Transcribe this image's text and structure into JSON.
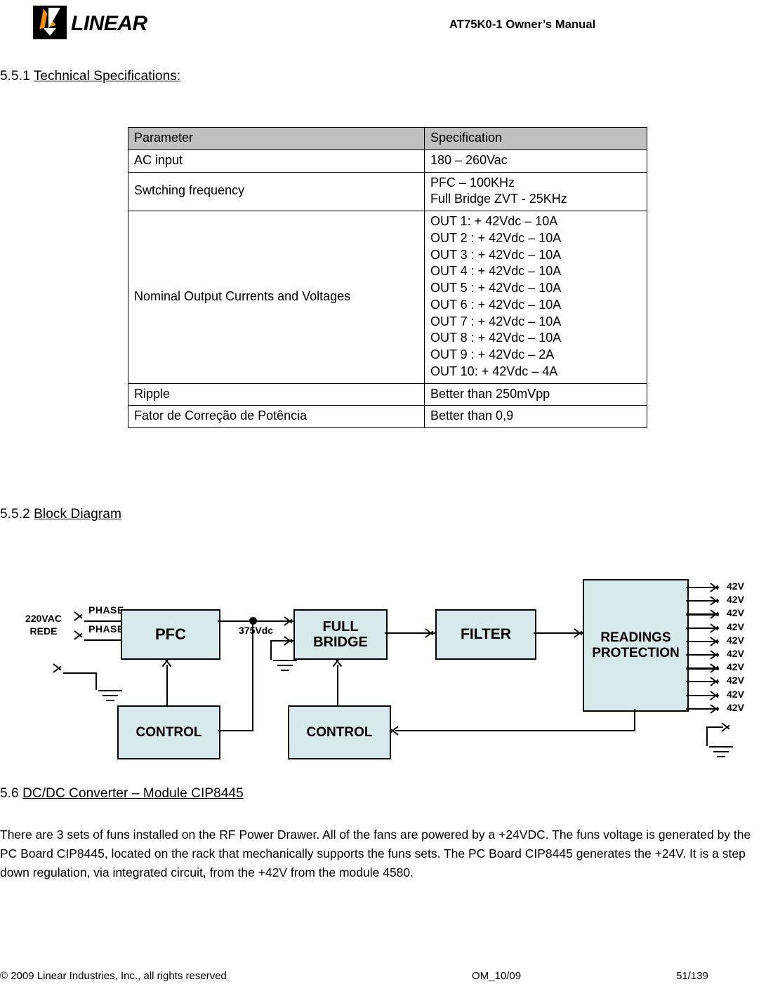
{
  "header": {
    "logo_text": "LINEAR",
    "document_title": "AT75K0-1 Owner’s Manual"
  },
  "sections": {
    "spec": {
      "number": "5.5.1",
      "title": "Technical Specifications:"
    },
    "block": {
      "number": "5.5.2",
      "title": "Block Diagram"
    },
    "dcdc": {
      "number": "5.6",
      "title": "DC/DC Converter – Module CIP8445"
    }
  },
  "spec_table": {
    "columns": [
      "Parameter",
      "Specification"
    ],
    "rows": [
      {
        "parameter": "AC input",
        "specification": "180 – 260Vac"
      },
      {
        "parameter": "Swtching frequency",
        "specification_lines": [
          "PFC – 100KHz",
          "Full Bridge ZVT - 25KHz"
        ]
      },
      {
        "parameter": "Nominal Output Currents and Voltages",
        "specification_lines": [
          "OUT 1: + 42Vdc – 10A",
          "OUT 2 : + 42Vdc – 10A",
          "OUT 3 : + 42Vdc – 10A",
          "OUT 4 : + 42Vdc – 10A",
          "OUT 5 : + 42Vdc – 10A",
          "OUT 6 : + 42Vdc – 10A",
          "OUT 7 : + 42Vdc – 10A",
          "OUT 8 : + 42Vdc – 10A",
          "OUT 9 : + 42Vdc – 2A",
          "OUT 10: + 42Vdc – 4A"
        ]
      },
      {
        "parameter": "Ripple",
        "specification": "Better than 250mVpp"
      },
      {
        "parameter": "Fator de Correção de Potência",
        "specification": "Better than  0,9"
      }
    ]
  },
  "block_diagram": {
    "input_label_lines": [
      "220VAC",
      "REDE"
    ],
    "phase_labels": [
      "PHASE",
      "PHASE"
    ],
    "bus_label": "375Vdc",
    "blocks": {
      "pfc": "PFC",
      "full_bridge_lines": [
        "FULL",
        "BRIDGE"
      ],
      "filter": "FILTER",
      "readings_lines": [
        "READINGS",
        "PROTECTION"
      ],
      "control_left": "CONTROL",
      "control_right": "CONTROL"
    },
    "outputs": [
      "42V",
      "42V",
      "42V",
      "42V",
      "42V",
      "42V",
      "42V",
      "42V",
      "42V",
      "42V"
    ],
    "block_fill_color": "#d8e9ec",
    "line_color": "#000000"
  },
  "body_text": {
    "dcdc_paragraph": "There are 3 sets of funs installed on the RF Power Drawer. All of the fans are powered by a +24VDC. The funs voltage is generated by the PC Board CIP8445, located on the rack that mechanically supports the funs sets. The PC Board CIP8445 generates the +24V. It is a step down regulation, via integrated circuit, from the +42V from the module 4580."
  },
  "footer": {
    "copyright": "© 2009 Linear Industries, Inc., all rights reserved",
    "doc_code": "OM_10/09",
    "page": "51/139"
  }
}
